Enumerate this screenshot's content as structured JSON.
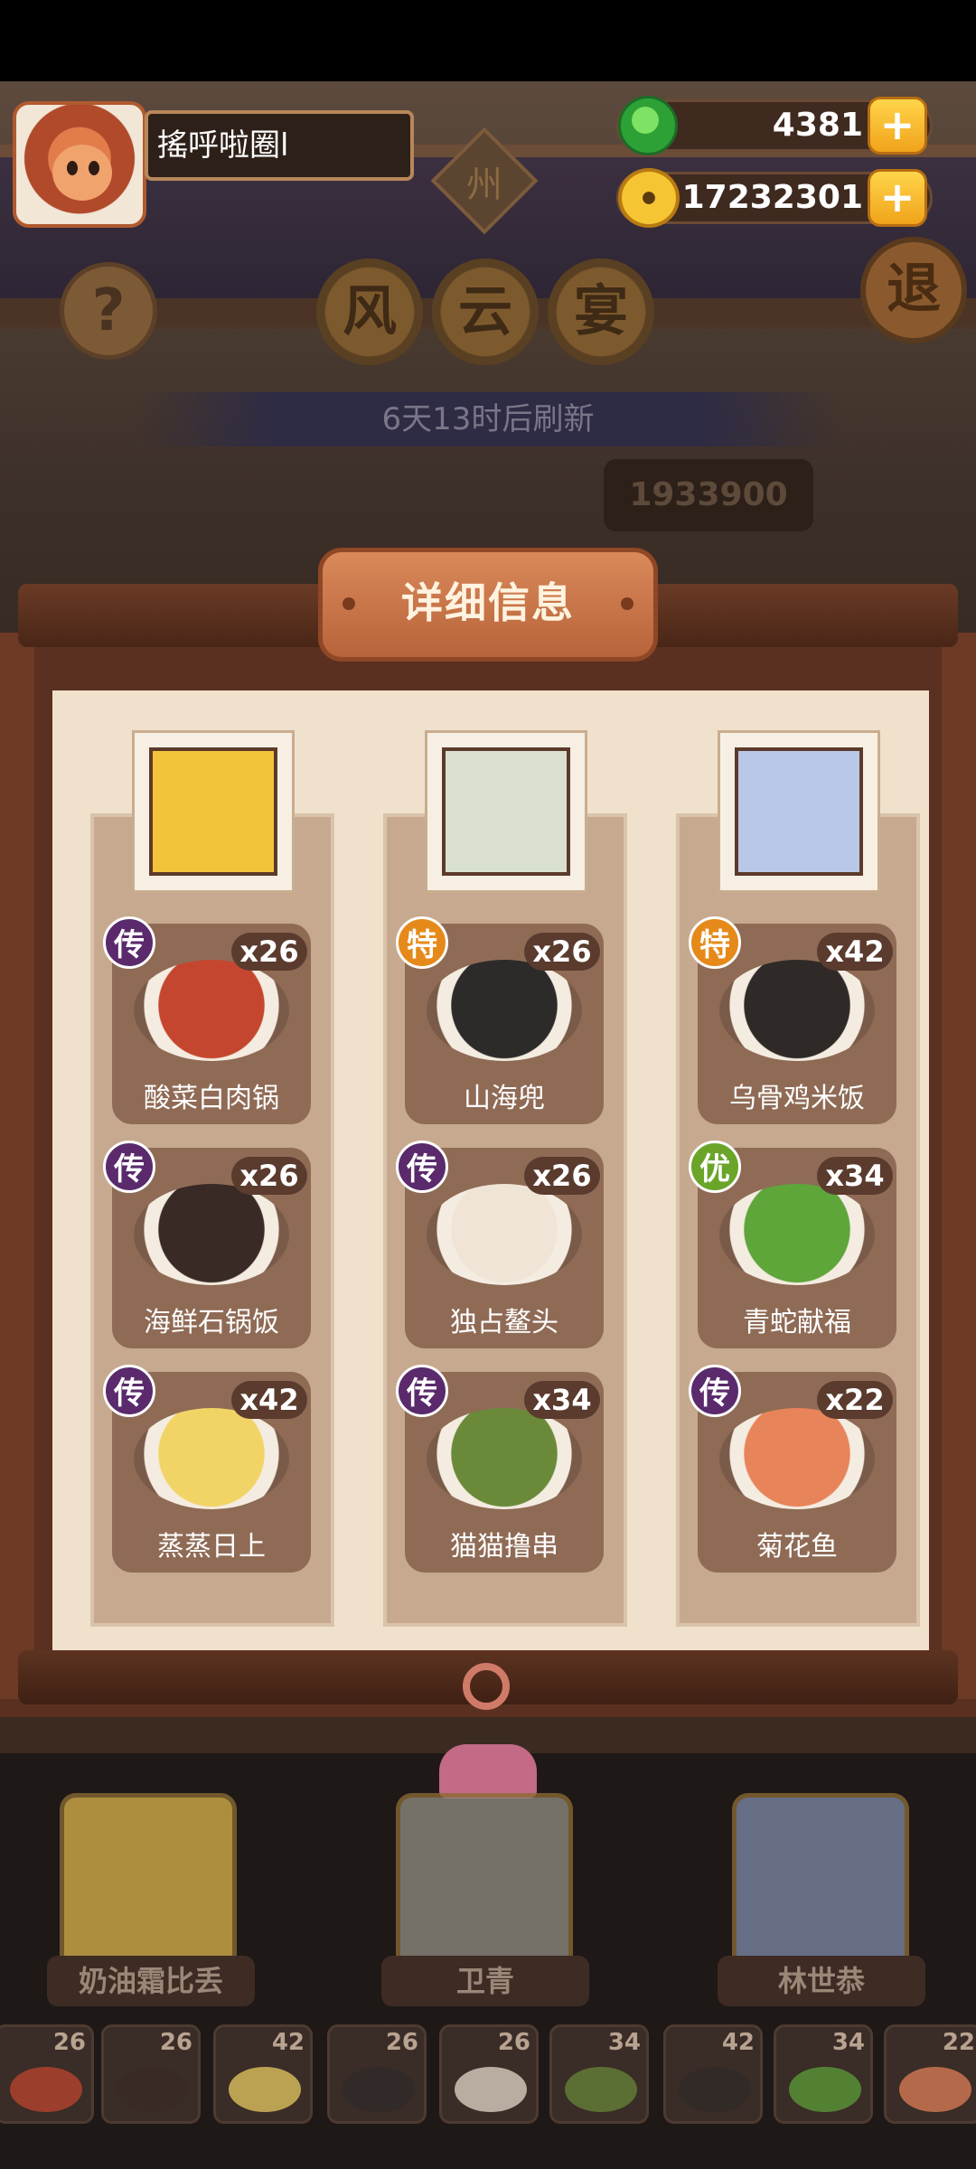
{
  "player": {
    "name": "搖呼啦圈l"
  },
  "currency": {
    "jade": "4381",
    "coins": "17232301",
    "add_symbol": "+"
  },
  "header": {
    "region": "州",
    "event_chars": [
      "风",
      "云",
      "宴"
    ],
    "help": "?",
    "exit": "退",
    "refresh_text": "6天13时后刷新",
    "score": "1933900"
  },
  "panel": {
    "title": "详细信息",
    "columns": [
      {
        "dishes": [
          {
            "name": "酸菜白肉锅",
            "count": "x26",
            "grade": "传",
            "color": "#c5462f"
          },
          {
            "name": "海鲜石锅饭",
            "count": "x26",
            "grade": "传",
            "color": "#3a2a26"
          },
          {
            "name": "蒸蒸日上",
            "count": "x42",
            "grade": "传",
            "color": "#f2d466"
          }
        ]
      },
      {
        "dishes": [
          {
            "name": "山海兜",
            "count": "x26",
            "grade": "特",
            "color": "#2d2a2a"
          },
          {
            "name": "独占鳌头",
            "count": "x26",
            "grade": "传",
            "color": "#efe4d6"
          },
          {
            "name": "猫猫撸串",
            "count": "x34",
            "grade": "传",
            "color": "#6a8a3a"
          }
        ]
      },
      {
        "dishes": [
          {
            "name": "乌骨鸡米饭",
            "count": "x42",
            "grade": "特",
            "color": "#2f2a28"
          },
          {
            "name": "青蛇献福",
            "count": "x34",
            "grade": "优",
            "color": "#5ea53a"
          },
          {
            "name": "菊花鱼",
            "count": "x22",
            "grade": "传",
            "color": "#e8845a"
          }
        ]
      }
    ]
  },
  "chefs": [
    {
      "name": "奶油霜比丢"
    },
    {
      "name": "卫青"
    },
    {
      "name": "林世恭"
    }
  ],
  "dish_strip": [
    {
      "count": "26",
      "color": "#c5462f"
    },
    {
      "count": "26",
      "color": "#3a2a26"
    },
    {
      "count": "42",
      "color": "#f2d466"
    },
    {
      "count": "26",
      "color": "#2d2a2a"
    },
    {
      "count": "26",
      "color": "#efe4d6"
    },
    {
      "count": "34",
      "color": "#6a8a3a"
    },
    {
      "count": "42",
      "color": "#2f2a28"
    },
    {
      "count": "34",
      "color": "#5ea53a"
    },
    {
      "count": "22",
      "color": "#e8845a"
    }
  ]
}
